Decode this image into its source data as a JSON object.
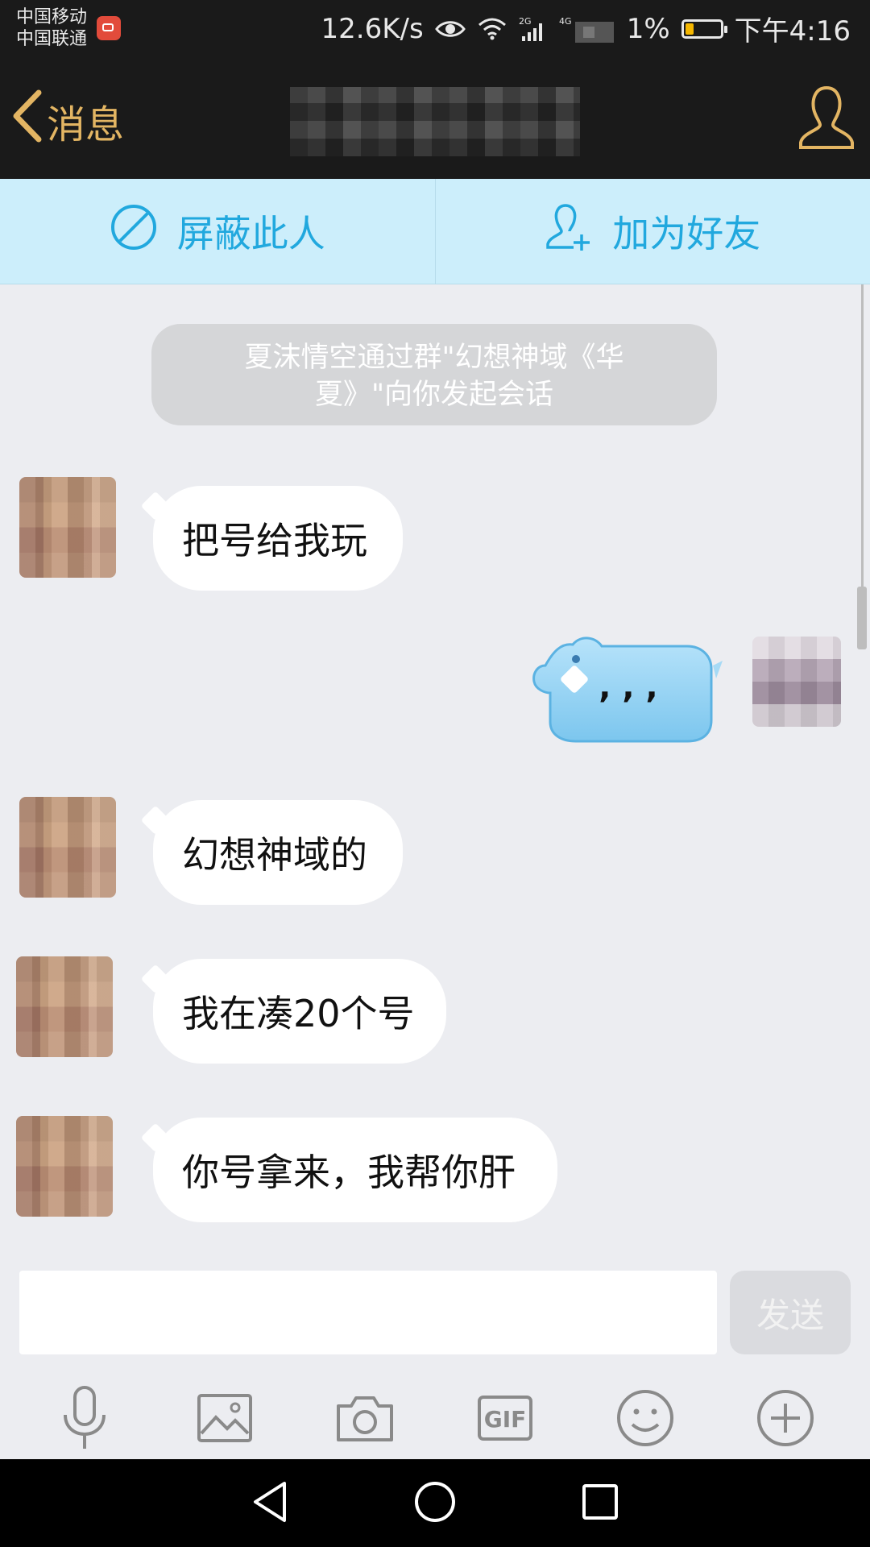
{
  "status_bar": {
    "carrier_1": "中国移动",
    "carrier_2": "中国联通",
    "speed": "12.6K/s",
    "battery_percent": "1%",
    "time": "下午4:16",
    "signal_2g": "2G",
    "signal_4g": "4G"
  },
  "header": {
    "back_label": "消息",
    "title": ""
  },
  "actions": {
    "block_label": "屏蔽此人",
    "add_friend_label": "加为好友"
  },
  "chat": {
    "system_notice": "夏沫情空通过群\"幻想神域《华夏》\"向你发起会话",
    "messages": [
      {
        "side": "left",
        "text": "把号给我玩"
      },
      {
        "side": "right",
        "text": ", , ,"
      },
      {
        "side": "left",
        "text": "幻想神域的"
      },
      {
        "side": "left",
        "text": "我在凑20个号"
      },
      {
        "side": "left",
        "text": "你号拿来，我帮你肝"
      }
    ]
  },
  "input": {
    "value": "",
    "placeholder": "",
    "send_label": "发送"
  },
  "toolbar": {
    "items": [
      "microphone-icon",
      "image-icon",
      "camera-icon",
      "gif-icon",
      "emoji-icon",
      "plus-icon"
    ],
    "gif_label": "GIF"
  },
  "colors": {
    "accent_gold": "#E3B563",
    "action_blue": "#21A8DE",
    "action_bg": "#CCEEFB",
    "chat_bg": "#ECEDF1"
  }
}
